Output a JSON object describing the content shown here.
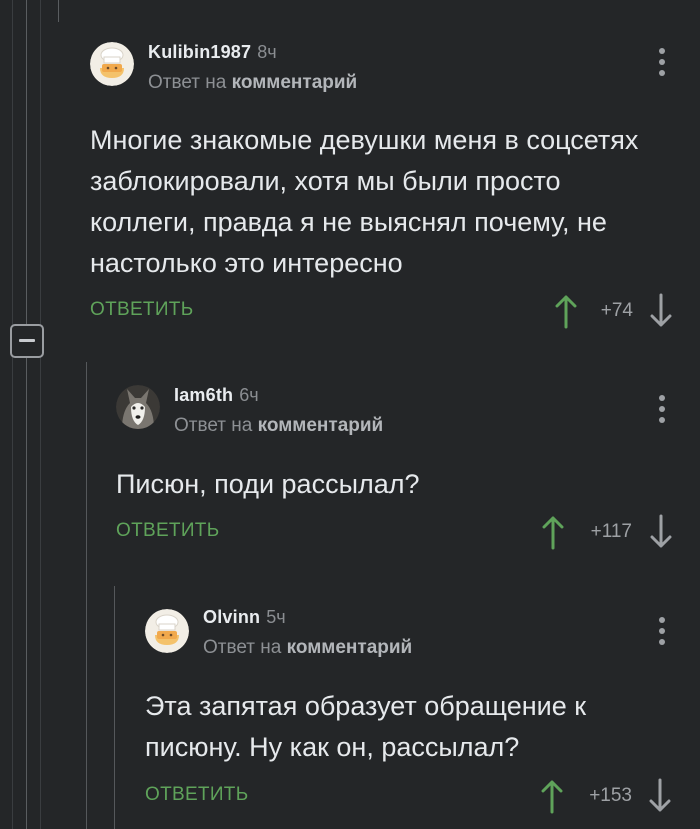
{
  "comments": [
    {
      "author": "Kulibin1987",
      "age": "8ч",
      "reply_prefix": "Ответ на",
      "reply_link": "комментарий",
      "text": "Многие знакомые девушки меня в соцсетях заблокировали, хотя мы были просто коллеги, правда я не выяснял почему, не настолько это интересно",
      "reply_label": "ОТВЕТИТЬ",
      "score": "+74",
      "avatar_icon": "chef-avatar-icon"
    },
    {
      "author": "Iam6th",
      "age": "6ч",
      "reply_prefix": "Ответ на",
      "reply_link": "комментарий",
      "text": "Писюн, поди рассылал?",
      "reply_label": "ОТВЕТИТЬ",
      "score": "+117",
      "avatar_icon": "husky-avatar-icon"
    },
    {
      "author": "Olvinn",
      "age": "5ч",
      "reply_prefix": "Ответ на",
      "reply_link": "комментарий",
      "text": "Эта запятая образует обращение к писюну. Ну как он, рассылал?",
      "reply_label": "ОТВЕТИТЬ",
      "score": "+153",
      "avatar_icon": "chef-avatar-icon"
    }
  ],
  "colors": {
    "background": "#242628",
    "accent_green": "#5fa35a",
    "text": "#e6e9ec",
    "muted": "#8d9094"
  },
  "icons": {
    "collapse": "collapse-minus-icon",
    "menu": "more-vertical-icon",
    "upvote": "arrow-up-icon",
    "downvote": "arrow-down-icon"
  }
}
